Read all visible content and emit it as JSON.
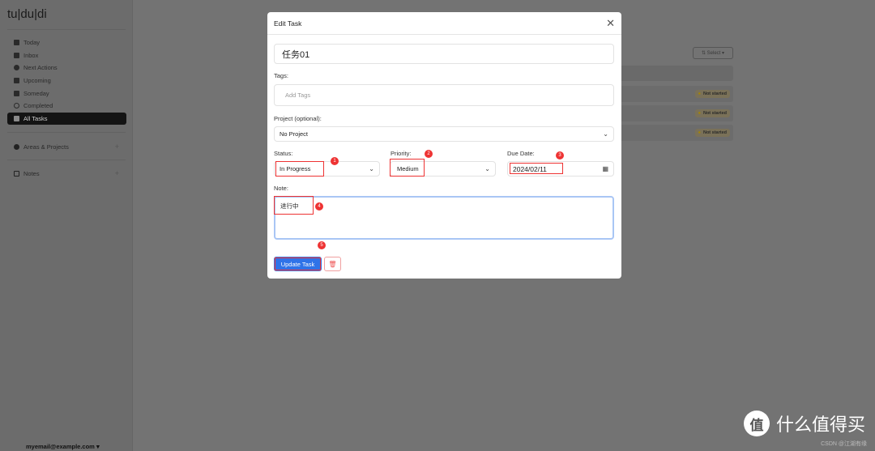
{
  "sidebar": {
    "logo": "tu|du|di",
    "items": [
      {
        "label": "Today"
      },
      {
        "label": "Inbox"
      },
      {
        "label": "Next Actions"
      },
      {
        "label": "Upcoming"
      },
      {
        "label": "Someday"
      },
      {
        "label": "Completed"
      },
      {
        "label": "All Tasks"
      }
    ],
    "areas": "Areas & Projects",
    "notes": "Notes",
    "plus": "+",
    "user": "myemail@example.com ▾"
  },
  "main": {
    "select": "⇅ Select ▾",
    "badges": [
      "Not started",
      "Not started",
      "Not started"
    ]
  },
  "modal": {
    "title": "Edit Task",
    "close": "✕",
    "task_name": "任务01",
    "tags_label": "Tags:",
    "tags_placeholder": "Add Tags",
    "project_label": "Project (optional):",
    "project_value": "No Project",
    "status_label": "Status:",
    "status_value": "In Progress",
    "priority_label": "Priority:",
    "priority_value": "Medium",
    "due_label": "Due Date:",
    "due_value": "2024/02/11",
    "note_label": "Note:",
    "note_value": "进行中",
    "update": "Update Task",
    "delete_icon": "🗑"
  },
  "annotations": [
    "1",
    "2",
    "3",
    "4",
    "5"
  ],
  "watermark": {
    "logo": "值",
    "text": "什么值得买",
    "sub": "CSDN @江湖有缘"
  }
}
